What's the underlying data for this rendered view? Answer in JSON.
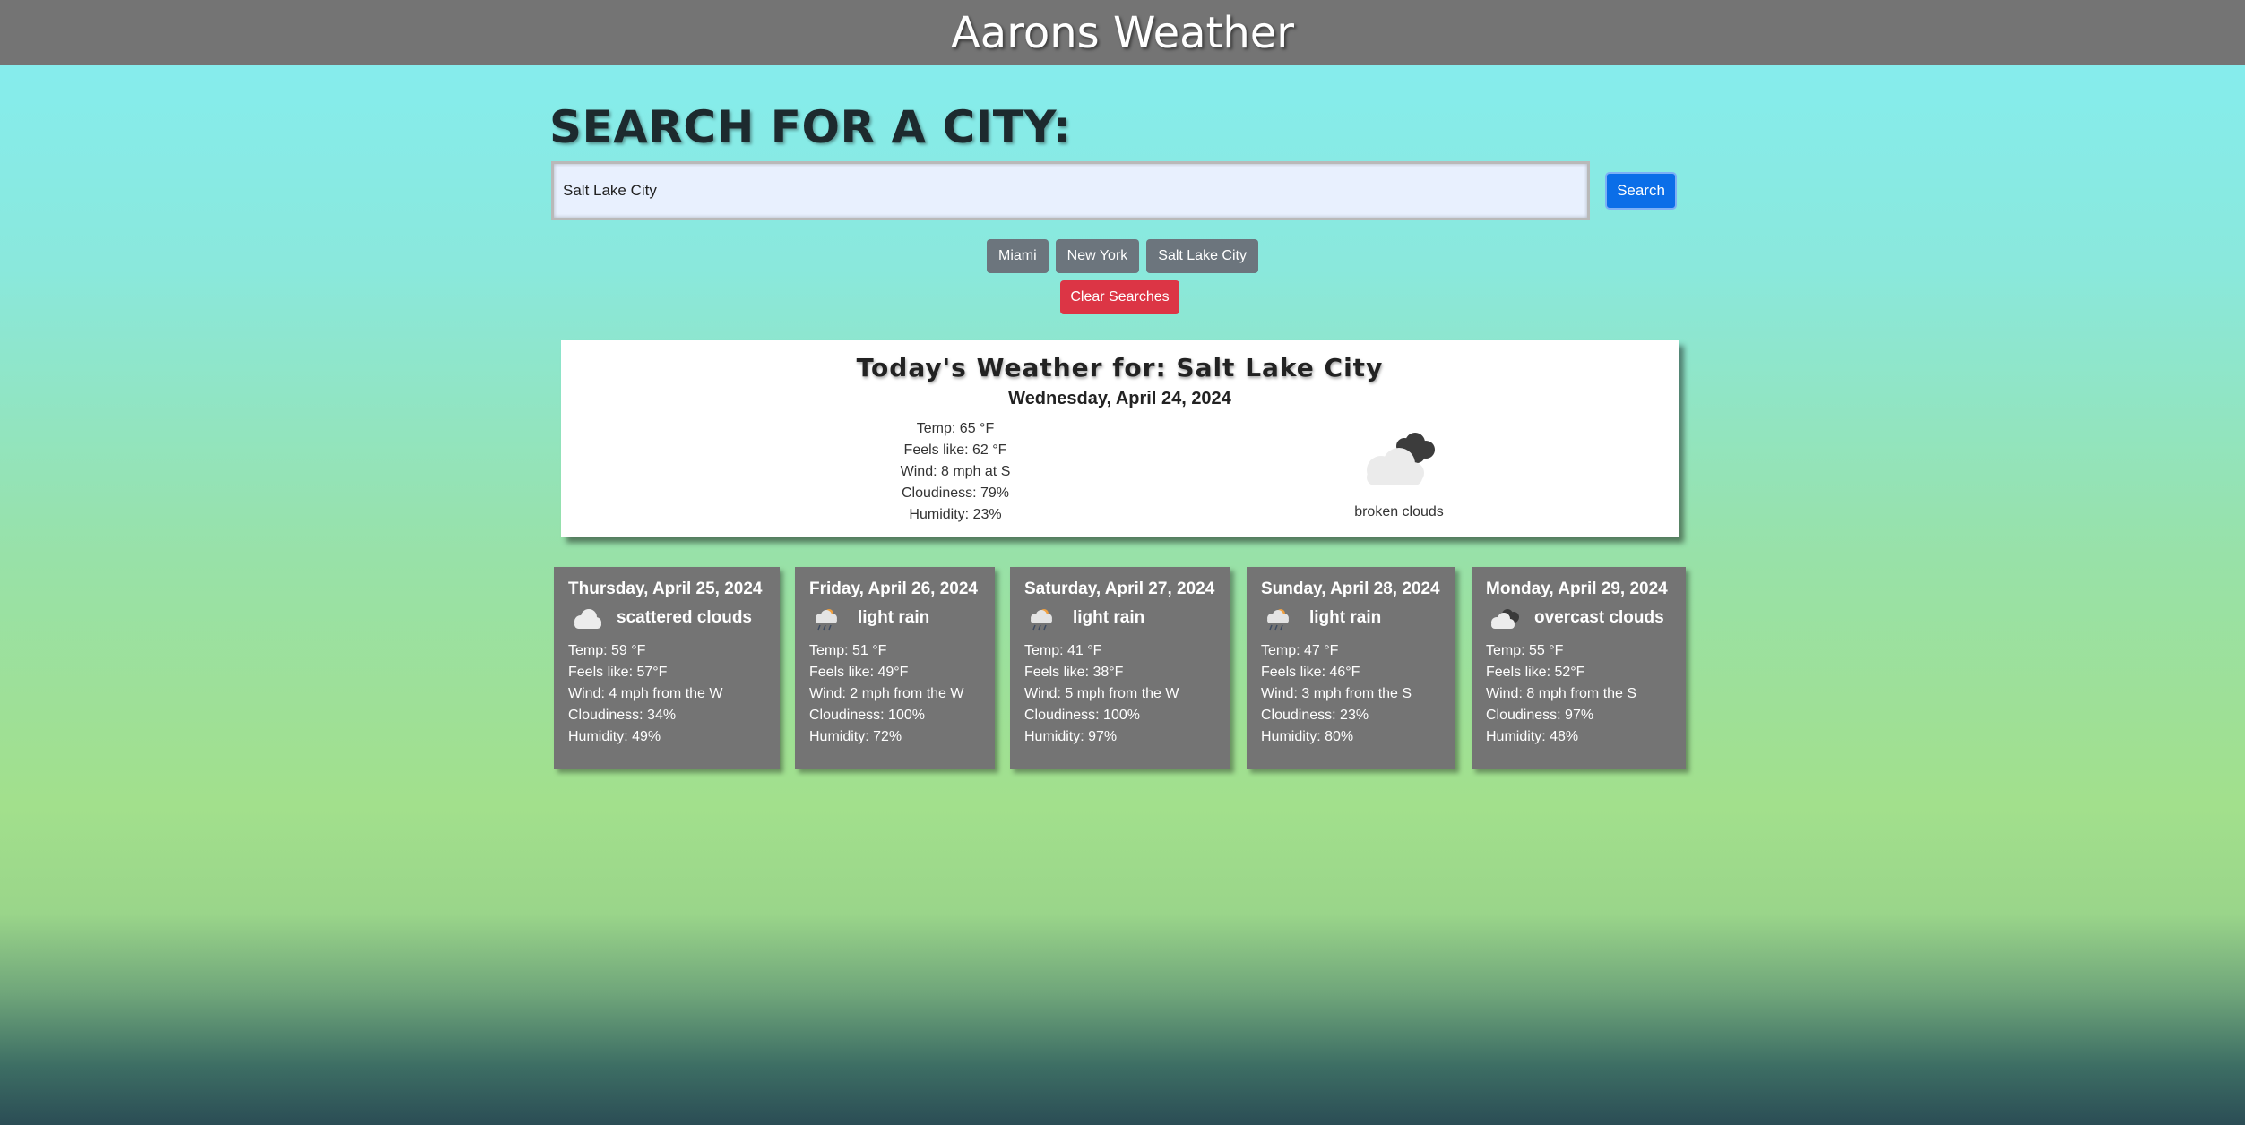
{
  "header": {
    "title": "Aarons Weather"
  },
  "search": {
    "heading": "SEARCH FOR A CITY:",
    "value": "Salt Lake City",
    "button_label": "Search"
  },
  "history": {
    "cities": [
      "Miami",
      "New York",
      "Salt Lake City"
    ],
    "clear_label": "Clear Searches"
  },
  "today": {
    "title": "Today's Weather for: Salt Lake City",
    "date": "Wednesday, April 24, 2024",
    "temp": "Temp: 65 °F",
    "feels": "Feels like: 62 °F",
    "wind": "Wind: 8 mph at S",
    "cloudiness": "Cloudiness: 79%",
    "humidity": "Humidity: 23%",
    "icon": "broken-clouds-icon",
    "description": "broken clouds"
  },
  "forecast": [
    {
      "date": "Thursday, April 25, 2024",
      "icon": "scattered-clouds-icon",
      "description": "scattered clouds",
      "temp": "Temp: 59 °F",
      "feels": "Feels like: 57°F",
      "wind": "Wind: 4 mph from the W",
      "cloudiness": "Cloudiness: 34%",
      "humidity": "Humidity: 49%"
    },
    {
      "date": "Friday, April 26, 2024",
      "icon": "light-rain-icon",
      "description": "light rain",
      "temp": "Temp: 51 °F",
      "feels": "Feels like: 49°F",
      "wind": "Wind: 2 mph from the W",
      "cloudiness": "Cloudiness: 100%",
      "humidity": "Humidity: 72%"
    },
    {
      "date": "Saturday, April 27, 2024",
      "icon": "light-rain-icon",
      "description": "light rain",
      "temp": "Temp: 41 °F",
      "feels": "Feels like: 38°F",
      "wind": "Wind: 5 mph from the W",
      "cloudiness": "Cloudiness: 100%",
      "humidity": "Humidity: 97%"
    },
    {
      "date": "Sunday, April 28, 2024",
      "icon": "light-rain-icon",
      "description": "light rain",
      "temp": "Temp: 47 °F",
      "feels": "Feels like: 46°F",
      "wind": "Wind: 3 mph from the S",
      "cloudiness": "Cloudiness: 23%",
      "humidity": "Humidity: 80%"
    },
    {
      "date": "Monday, April 29, 2024",
      "icon": "overcast-clouds-icon",
      "description": "overcast clouds",
      "temp": "Temp: 55 °F",
      "feels": "Feels like: 52°F",
      "wind": "Wind: 8 mph from the S",
      "cloudiness": "Cloudiness: 97%",
      "humidity": "Humidity: 48%"
    }
  ],
  "colors": {
    "header_bg": "#747474",
    "search_button": "#0b6ee8",
    "history_button": "#6c757d",
    "clear_button": "#dc3545",
    "forecast_card": "#747474"
  }
}
